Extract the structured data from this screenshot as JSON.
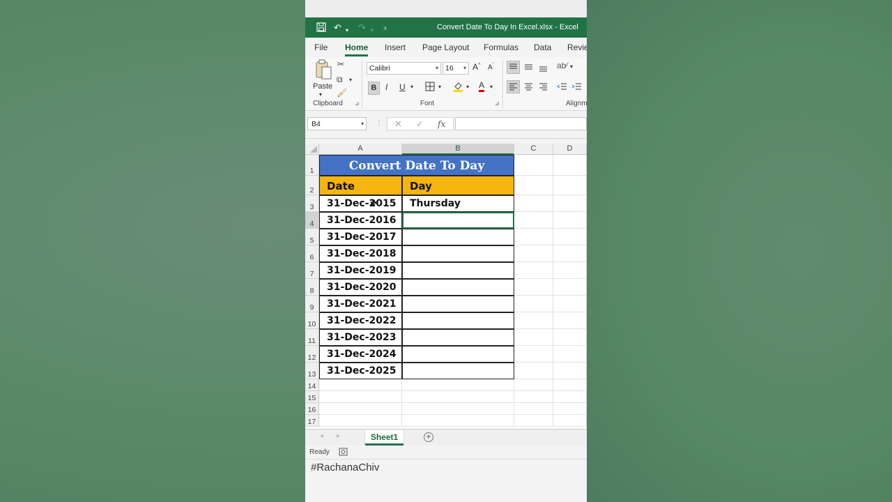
{
  "window": {
    "title": "Convert Date To Day In Excel.xlsx  -  Excel"
  },
  "ribbon_tabs": [
    "File",
    "Home",
    "Insert",
    "Page Layout",
    "Formulas",
    "Data",
    "Revie"
  ],
  "ribbon": {
    "paste_label": "Paste",
    "font_name": "Calibri",
    "font_size": "16",
    "bold": "B",
    "italic": "I",
    "underline": "U",
    "font_color": "A",
    "grow_font": "A",
    "shrink_font": "A",
    "groups": {
      "clipboard": "Clipboard",
      "font": "Font",
      "alignment": "Alignm"
    }
  },
  "formula_bar": {
    "name_box": "B4",
    "fx": "fx",
    "value": ""
  },
  "columns": [
    "A",
    "B",
    "C",
    "D"
  ],
  "rows": [
    "1",
    "2",
    "3",
    "4",
    "5",
    "6",
    "7",
    "8",
    "9",
    "10",
    "11",
    "12",
    "13",
    "14",
    "15",
    "16",
    "17"
  ],
  "table": {
    "title": "Convert Date To Day",
    "headers": [
      "Date",
      "Day"
    ],
    "dates": [
      "31-Dec-2015",
      "31-Dec-2016",
      "31-Dec-2017",
      "31-Dec-2018",
      "31-Dec-2019",
      "31-Dec-2020",
      "31-Dec-2021",
      "31-Dec-2022",
      "31-Dec-2023",
      "31-Dec-2024",
      "31-Dec-2025"
    ],
    "days": [
      "Thursday",
      "",
      "",
      "",
      "",
      "",
      "",
      "",
      "",
      "",
      ""
    ]
  },
  "sheet_tabs": [
    "Sheet1"
  ],
  "status": {
    "ready": "Ready"
  },
  "caption": "#RachanaChiv",
  "colors": {
    "excel_green": "#217346",
    "title_blue": "#4472c4",
    "header_orange": "#f6b40f"
  }
}
